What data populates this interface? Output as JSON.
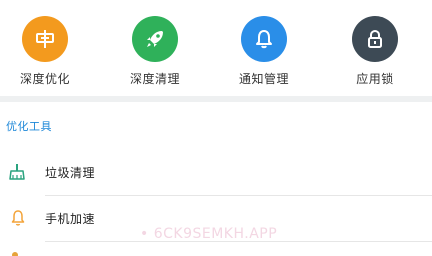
{
  "quick_actions": [
    {
      "label": "深度优化",
      "icon": "signpost-icon",
      "color": "#f39a1e"
    },
    {
      "label": "深度清理",
      "icon": "rocket-icon",
      "color": "#2fb15a"
    },
    {
      "label": "通知管理",
      "icon": "bell-icon",
      "color": "#2a8ee8"
    },
    {
      "label": "应用锁",
      "icon": "lock-icon",
      "color": "#3d4a55"
    }
  ],
  "section": {
    "title": "优化工具"
  },
  "tools": [
    {
      "label": "垃圾清理",
      "icon": "broom-icon",
      "color": "#2aa37f"
    },
    {
      "label": "手机加速",
      "icon": "bell-icon",
      "color": "#f3a43a"
    }
  ],
  "watermark": "• 6CK9SEMKH.APP"
}
